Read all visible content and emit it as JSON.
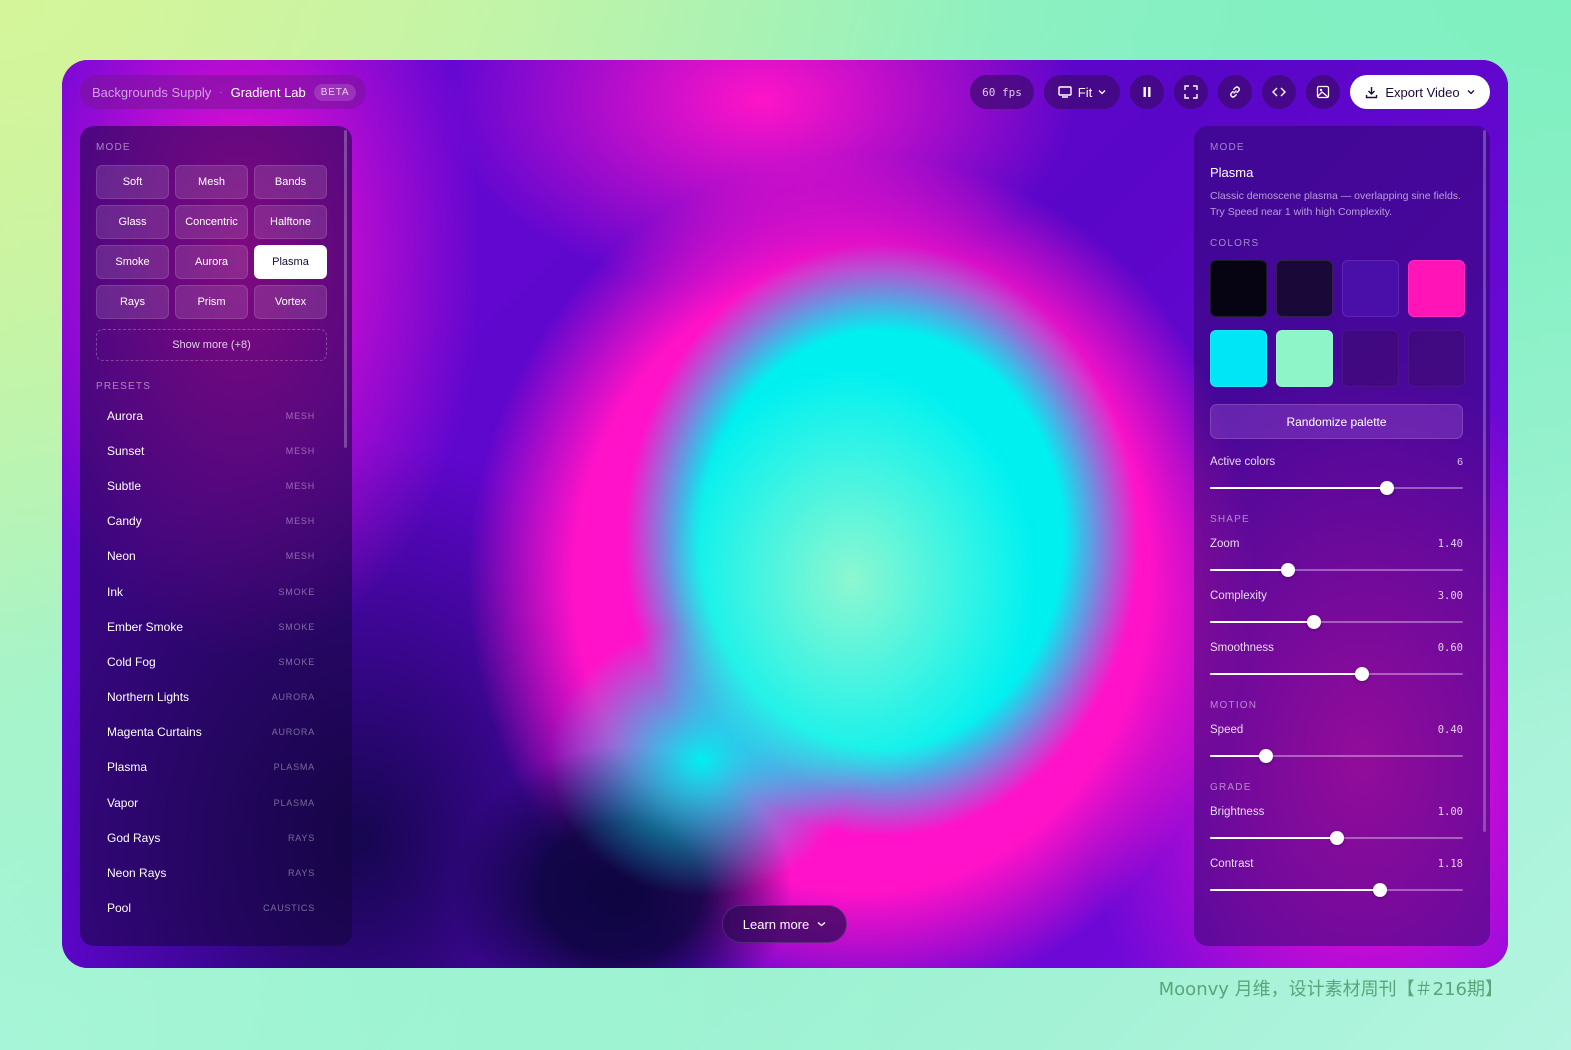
{
  "header": {
    "brand": "Backgrounds Supply",
    "separator": "·",
    "app_name": "Gradient Lab",
    "badge": "BETA"
  },
  "toolbar": {
    "fps": "60 fps",
    "fit_label": "Fit",
    "export_label": "Export Video"
  },
  "left": {
    "mode_label": "MODE",
    "modes": [
      {
        "label": "Soft"
      },
      {
        "label": "Mesh"
      },
      {
        "label": "Bands"
      },
      {
        "label": "Glass"
      },
      {
        "label": "Concentric"
      },
      {
        "label": "Halftone"
      },
      {
        "label": "Smoke"
      },
      {
        "label": "Aurora"
      },
      {
        "label": "Plasma",
        "active": true
      },
      {
        "label": "Rays"
      },
      {
        "label": "Prism"
      },
      {
        "label": "Vortex"
      }
    ],
    "show_more": "Show more (+8)",
    "presets_label": "PRESETS",
    "presets": [
      {
        "name": "Aurora",
        "tag": "MESH"
      },
      {
        "name": "Sunset",
        "tag": "MESH"
      },
      {
        "name": "Subtle",
        "tag": "MESH"
      },
      {
        "name": "Candy",
        "tag": "MESH"
      },
      {
        "name": "Neon",
        "tag": "MESH"
      },
      {
        "name": "Ink",
        "tag": "SMOKE"
      },
      {
        "name": "Ember Smoke",
        "tag": "SMOKE"
      },
      {
        "name": "Cold Fog",
        "tag": "SMOKE"
      },
      {
        "name": "Northern Lights",
        "tag": "AURORA"
      },
      {
        "name": "Magenta Curtains",
        "tag": "AURORA"
      },
      {
        "name": "Plasma",
        "tag": "PLASMA"
      },
      {
        "name": "Vapor",
        "tag": "PLASMA"
      },
      {
        "name": "God Rays",
        "tag": "RAYS"
      },
      {
        "name": "Neon Rays",
        "tag": "RAYS"
      },
      {
        "name": "Pool",
        "tag": "CAUSTICS"
      }
    ]
  },
  "right": {
    "mode_label": "MODE",
    "mode_name": "Plasma",
    "mode_desc": "Classic demoscene plasma — overlapping sine fields. Try Speed near 1 with high Complexity.",
    "colors_label": "COLORS",
    "swatches": [
      "#060312",
      "#1a0838",
      "#4a0fa8",
      "#ff14b8",
      "#00e6f6",
      "#8ef5c8",
      "#3c0a6a",
      "#3c0a6a"
    ],
    "randomize_label": "Randomize palette",
    "active_colors": {
      "label": "Active colors",
      "value": "6",
      "fraction": 0.7
    },
    "shape_label": "SHAPE",
    "shape": [
      {
        "label": "Zoom",
        "value": "1.40",
        "fraction": 0.31
      },
      {
        "label": "Complexity",
        "value": "3.00",
        "fraction": 0.41
      },
      {
        "label": "Smoothness",
        "value": "0.60",
        "fraction": 0.6
      }
    ],
    "motion_label": "MOTION",
    "motion": [
      {
        "label": "Speed",
        "value": "0.40",
        "fraction": 0.22
      }
    ],
    "grade_label": "GRADE",
    "grade": [
      {
        "label": "Brightness",
        "value": "1.00",
        "fraction": 0.5
      },
      {
        "label": "Contrast",
        "value": "1.18",
        "fraction": 0.67
      }
    ]
  },
  "learn_more": "Learn more",
  "watermark": "Moonvy 月维，设计素材周刊【＃216期】"
}
